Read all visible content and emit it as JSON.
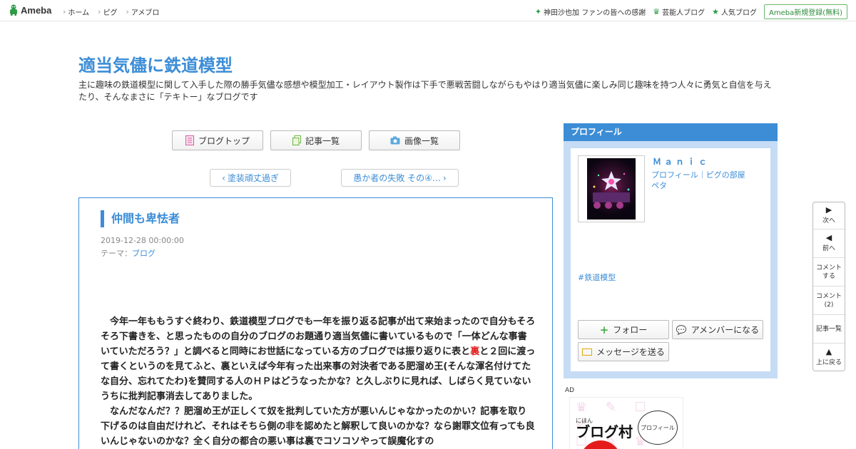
{
  "topbar": {
    "logo": "Ameba",
    "nav": [
      "ホーム",
      "ピグ",
      "アメブロ"
    ],
    "right": [
      {
        "icon": "sparkle-icon",
        "label": "神田沙也加 ファンの皆への感謝"
      },
      {
        "icon": "crown-icon",
        "label": "芸能人ブログ"
      },
      {
        "icon": "star-icon",
        "label": "人気ブログ"
      }
    ],
    "signup": "Ameba新規登録(無料)"
  },
  "blog": {
    "title": "適当気儘に鉄道模型",
    "description": "主に趣味の鉄道模型に関して入手した際の勝手気儘な感想や模型加工・レイアウト製作は下手で悪戦苦闘しながらもやはり適当気儘に楽しみ同じ趣味を持つ人々に勇気と自信を与えたり、そんなまさに「テキトー」なブログです"
  },
  "tools": {
    "top": "ブログトップ",
    "list": "記事一覧",
    "images": "画像一覧"
  },
  "pager": {
    "prev": "塗装頑丈過ぎ",
    "next": "愚か者の失敗 その④…"
  },
  "article": {
    "title": "仲間も卑怯者",
    "date": "2019-12-28 00:00:00",
    "theme_prefix": "テーマ：",
    "theme": "ブログ",
    "p1a": "　今年一年ももうすぐ終わり、鉄道模型ブログでも一年を振り返る記事が出て来始まったので自分もそろそろ下書きを、と思ったものの自分のブログのお題通り適当気儘に書いているもので「一体どんな事書いていただろう？」と調べると同時にお世話になっている方のブログでは振り返りに表と",
    "p1red": "裏",
    "p1b": "と２回に渡って書くというのを見てふと、裏といえば今年有った出来事の対決者である肥溜め王(そんな渾名付けてたな自分、忘れてたわ)を賛同する人のＨＰはどうなったかな？と久しぶりに見れば、しばらく見ていないうちに批判記事消去してありました。",
    "p2": "　なんだなんだ？？肥溜め王が正しくて奴を批判していた方が悪いんじゃなかったのかい？記事を取り下げるのは自由だけれど、それはそちら側の非を認めたと解釈して良いのかな？なら謝罪文位有っても良いんじゃないのかな？全く自分の都合の悪い事は裏でコソコソやって誤魔化すの"
  },
  "profile": {
    "header": "プロフィール",
    "name": "Ｍａｎｉｃ",
    "link1": "プロフィール",
    "sep": "｜",
    "link2": "ピグの部屋",
    "link3": "ペタ",
    "tag": "#鉄道模型",
    "follow": "フォロー",
    "member": "アメンバーになる",
    "message": "メッセージを送る"
  },
  "ad": {
    "label": "AD",
    "small": "にほん",
    "main": "ブログ村",
    "bubble": "プロフィール"
  },
  "floatnav": {
    "next": "次へ",
    "prev": "前へ",
    "comment": "コメントする",
    "comments": "コメント(2)",
    "list": "記事一覧",
    "top": "上に戻る"
  },
  "colors": {
    "accent": "#3c8dd6",
    "profile_bg": "#c6dcf5",
    "brand_green": "#2e9b46",
    "highlight_red": "#e02020"
  }
}
